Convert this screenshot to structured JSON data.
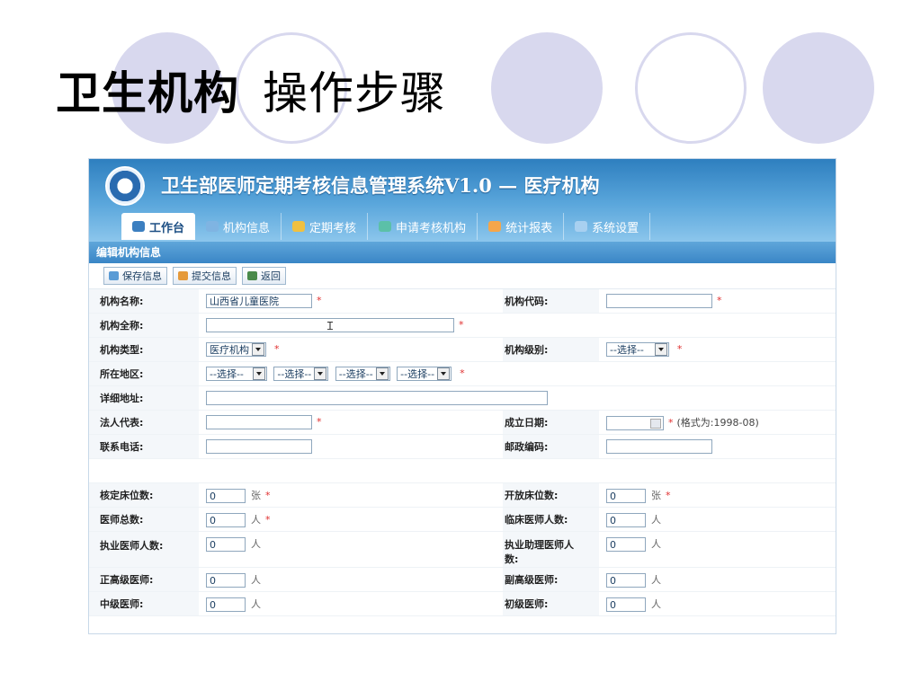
{
  "slide": {
    "title_bold": "卫生机构",
    "title_rest": "操作步骤"
  },
  "app": {
    "title": "卫生部医师定期考核信息管理系统V1.0 — 医疗机构",
    "tabs": [
      {
        "label": "工作台",
        "active": true,
        "icon": "workbench-icon",
        "color": "#3c7fc0"
      },
      {
        "label": "机构信息",
        "icon": "institution-icon",
        "color": "#7fb4e2"
      },
      {
        "label": "定期考核",
        "icon": "assessment-icon",
        "color": "#f0c040"
      },
      {
        "label": "申请考核机构",
        "icon": "apply-icon",
        "color": "#5bc0a8"
      },
      {
        "label": "统计报表",
        "icon": "report-icon",
        "color": "#f5a64a"
      },
      {
        "label": "系统设置",
        "icon": "settings-icon",
        "color": "#a8d0f0"
      }
    ],
    "section_title": "编辑机构信息",
    "toolbar": {
      "save": "保存信息",
      "submit": "提交信息",
      "back": "返回"
    },
    "form": {
      "name_label": "机构名称:",
      "name_value": "山西省儿童医院",
      "code_label": "机构代码:",
      "code_value": "",
      "fullname_label": "机构全称:",
      "fullname_value": "",
      "type_label": "机构类型:",
      "type_value": "医疗机构",
      "level_label": "机构级别:",
      "level_value": "--选择--",
      "region_label": "所在地区:",
      "region_selects": [
        "--选择--",
        "--选择--",
        "--选择--",
        "--选择--"
      ],
      "address_label": "详细地址:",
      "address_value": "",
      "legal_label": "法人代表:",
      "legal_value": "",
      "date_label": "成立日期:",
      "date_value": "",
      "date_hint": "(格式为:1998-08)",
      "phone_label": "联系电话:",
      "phone_value": "",
      "postal_label": "邮政编码:",
      "postal_value": "",
      "beds_label": "核定床位数:",
      "beds_value": "0",
      "beds_unit": "张",
      "open_beds_label": "开放床位数:",
      "open_beds_value": "0",
      "open_beds_unit": "张",
      "doctors_label": "医师总数:",
      "doctors_value": "0",
      "doctors_unit": "人",
      "clinical_label": "临床医师人数:",
      "clinical_value": "0",
      "clinical_unit": "人",
      "practicing_label": "执业医师人数:",
      "practicing_value": "0",
      "practicing_unit": "人",
      "assistant_label": "执业助理医师人数:",
      "assistant_value": "0",
      "assistant_unit": "人",
      "senior_label": "正高级医师:",
      "senior_value": "0",
      "senior_unit": "人",
      "assoc_senior_label": "副高级医师:",
      "assoc_senior_value": "0",
      "assoc_senior_unit": "人",
      "middle_label": "中级医师:",
      "middle_value": "0",
      "middle_unit": "人",
      "junior_label": "初级医师:",
      "junior_value": "0",
      "junior_unit": "人",
      "required_mark": "*"
    }
  }
}
